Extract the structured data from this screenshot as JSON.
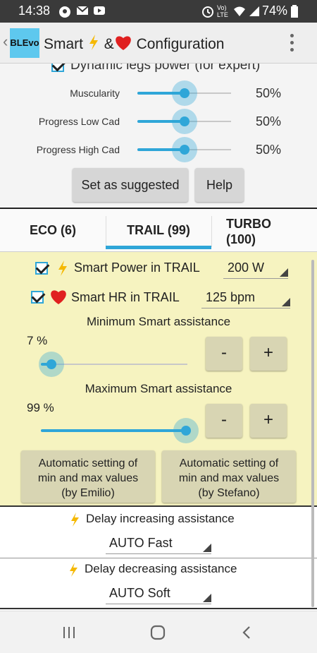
{
  "status_bar": {
    "time": "14:38",
    "battery": "74%",
    "network": "LTE"
  },
  "app_bar": {
    "logo_text": "BLEvo",
    "title_part1": "Smart",
    "title_part2": "&",
    "title_part3": "Configuration"
  },
  "dynamic_legs": {
    "label": "Dynamic legs power (for expert)",
    "checked": true,
    "sliders": [
      {
        "label": "Muscularity",
        "value": "50%",
        "level": 0.5
      },
      {
        "label": "Progress Low Cad",
        "value": "50%",
        "level": 0.5
      },
      {
        "label": "Progress High Cad",
        "value": "50%",
        "level": 0.5
      }
    ],
    "suggest_button": "Set as suggested",
    "help_button": "Help"
  },
  "tabs": [
    {
      "label": "ECO (6)"
    },
    {
      "label": "TRAIL (99)",
      "selected": true
    },
    {
      "label_line1": "TURBO",
      "label_line2": "(100)"
    }
  ],
  "trail": {
    "smart_power": {
      "label": "Smart Power in TRAIL",
      "value": "200 W",
      "checked": true
    },
    "smart_hr": {
      "label": "Smart HR in TRAIL",
      "value": "125 bpm",
      "checked": true
    },
    "min_assist": {
      "title": "Minimum Smart assistance",
      "value": "7 %",
      "level": 0.07,
      "minus": "-",
      "plus": "+"
    },
    "max_assist": {
      "title": "Maximum Smart assistance",
      "value": "99 %",
      "level": 0.99,
      "minus": "-",
      "plus": "+"
    },
    "auto_emilio": {
      "line1": "Automatic setting of",
      "line2": "min and max values",
      "line3": "(by Emilio)"
    },
    "auto_stefano": {
      "line1": "Automatic setting of",
      "line2": "min and max values",
      "line3": "(by Stefano)"
    }
  },
  "delay_increase": {
    "label": "Delay increasing assistance",
    "value": "AUTO Fast"
  },
  "delay_decrease": {
    "label": "Delay decreasing assistance",
    "value": "AUTO Soft"
  },
  "colors": {
    "accent": "#2fa6d8",
    "panel_bg": "#f6f3c0",
    "bolt": "#f5b800",
    "heart": "#e02020"
  }
}
